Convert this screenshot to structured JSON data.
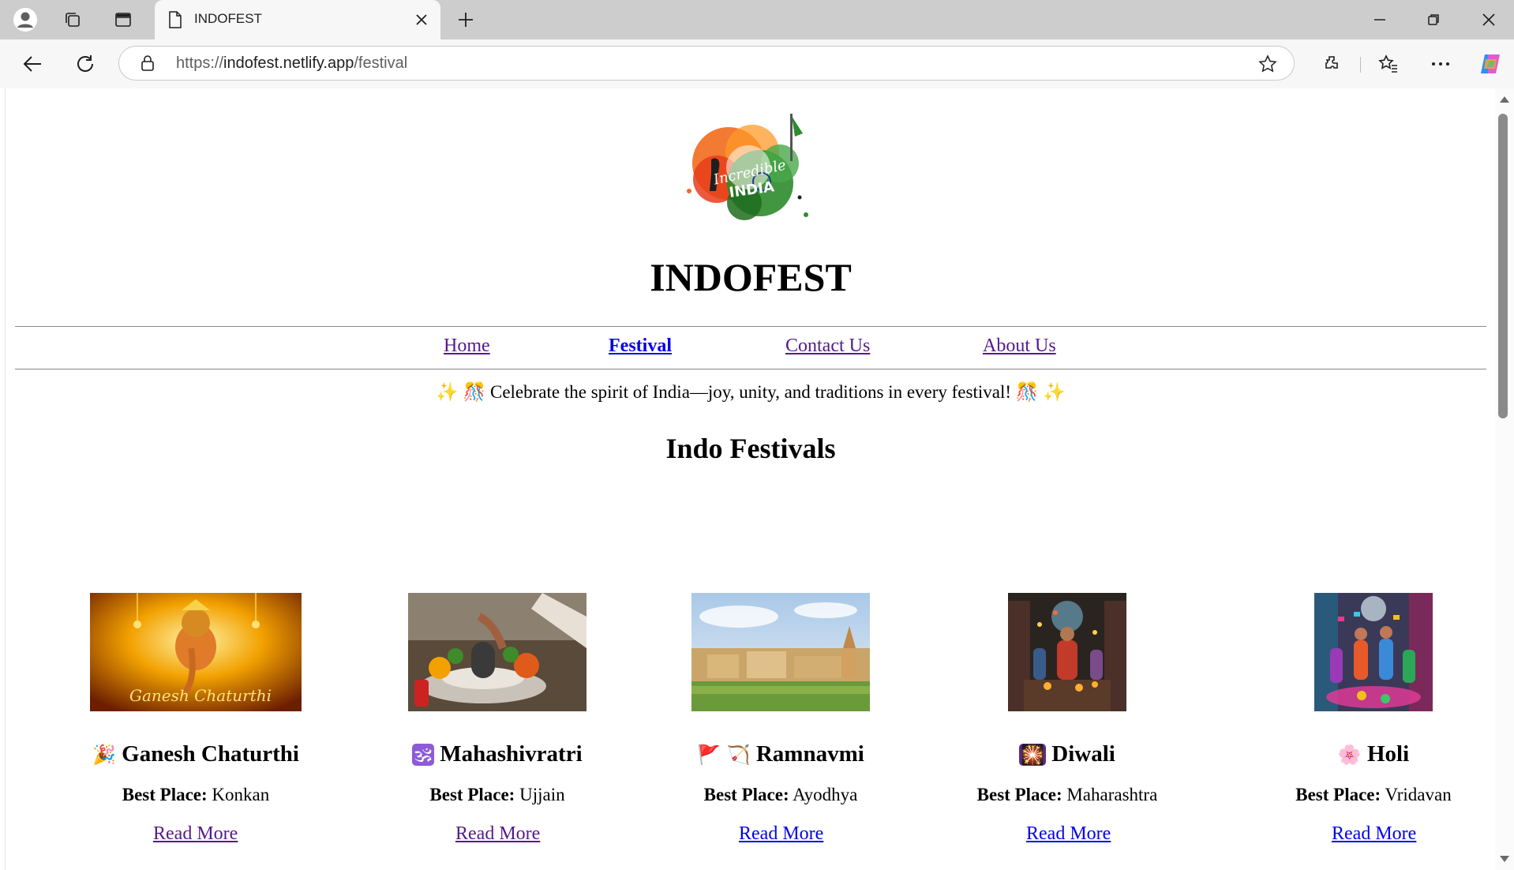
{
  "browser": {
    "tab_title": "INDOFEST",
    "url_scheme": "https://",
    "url_host": "indofest.netlify.app",
    "url_path": "/festival"
  },
  "site": {
    "logo_text_1": "Incredible",
    "logo_text_2": "INDIA",
    "title": "INDOFEST",
    "nav": [
      {
        "label": "Home",
        "active": false
      },
      {
        "label": "Festival",
        "active": true
      },
      {
        "label": "Contact Us",
        "active": false
      },
      {
        "label": "About Us",
        "active": false
      }
    ],
    "tagline": "✨ 🎊 Celebrate the spirit of India—joy, unity, and traditions in every festival! 🎊 ✨",
    "section_title": "Indo Festivals",
    "best_place_label": "Best Place:",
    "festivals": [
      {
        "emoji": "🎉",
        "name": "Ganesh Chaturthi",
        "image_caption": "Ganesh Chaturthi",
        "best_place": "Konkan",
        "link": "Read More",
        "link_visited": true
      },
      {
        "emoji": "🕉",
        "name": "Mahashivratri",
        "best_place": "Ujjain",
        "link": "Read More",
        "link_visited": true
      },
      {
        "emoji": "🚩 🏹",
        "name": "Ramnavmi",
        "best_place": "Ayodhya",
        "link": "Read More",
        "link_visited": false
      },
      {
        "emoji": "🎇",
        "name": "Diwali",
        "best_place": "Maharashtra",
        "link": "Read More",
        "link_visited": false
      },
      {
        "emoji": "🌸",
        "name": "Holi",
        "best_place": "Vridavan",
        "link": "Read More",
        "link_visited": false
      }
    ]
  },
  "colors": {
    "link": "#0000ee",
    "visited_link": "#551a8b",
    "chrome_bg": "#cdcdcd",
    "toolbar_bg": "#f7f7f7"
  }
}
